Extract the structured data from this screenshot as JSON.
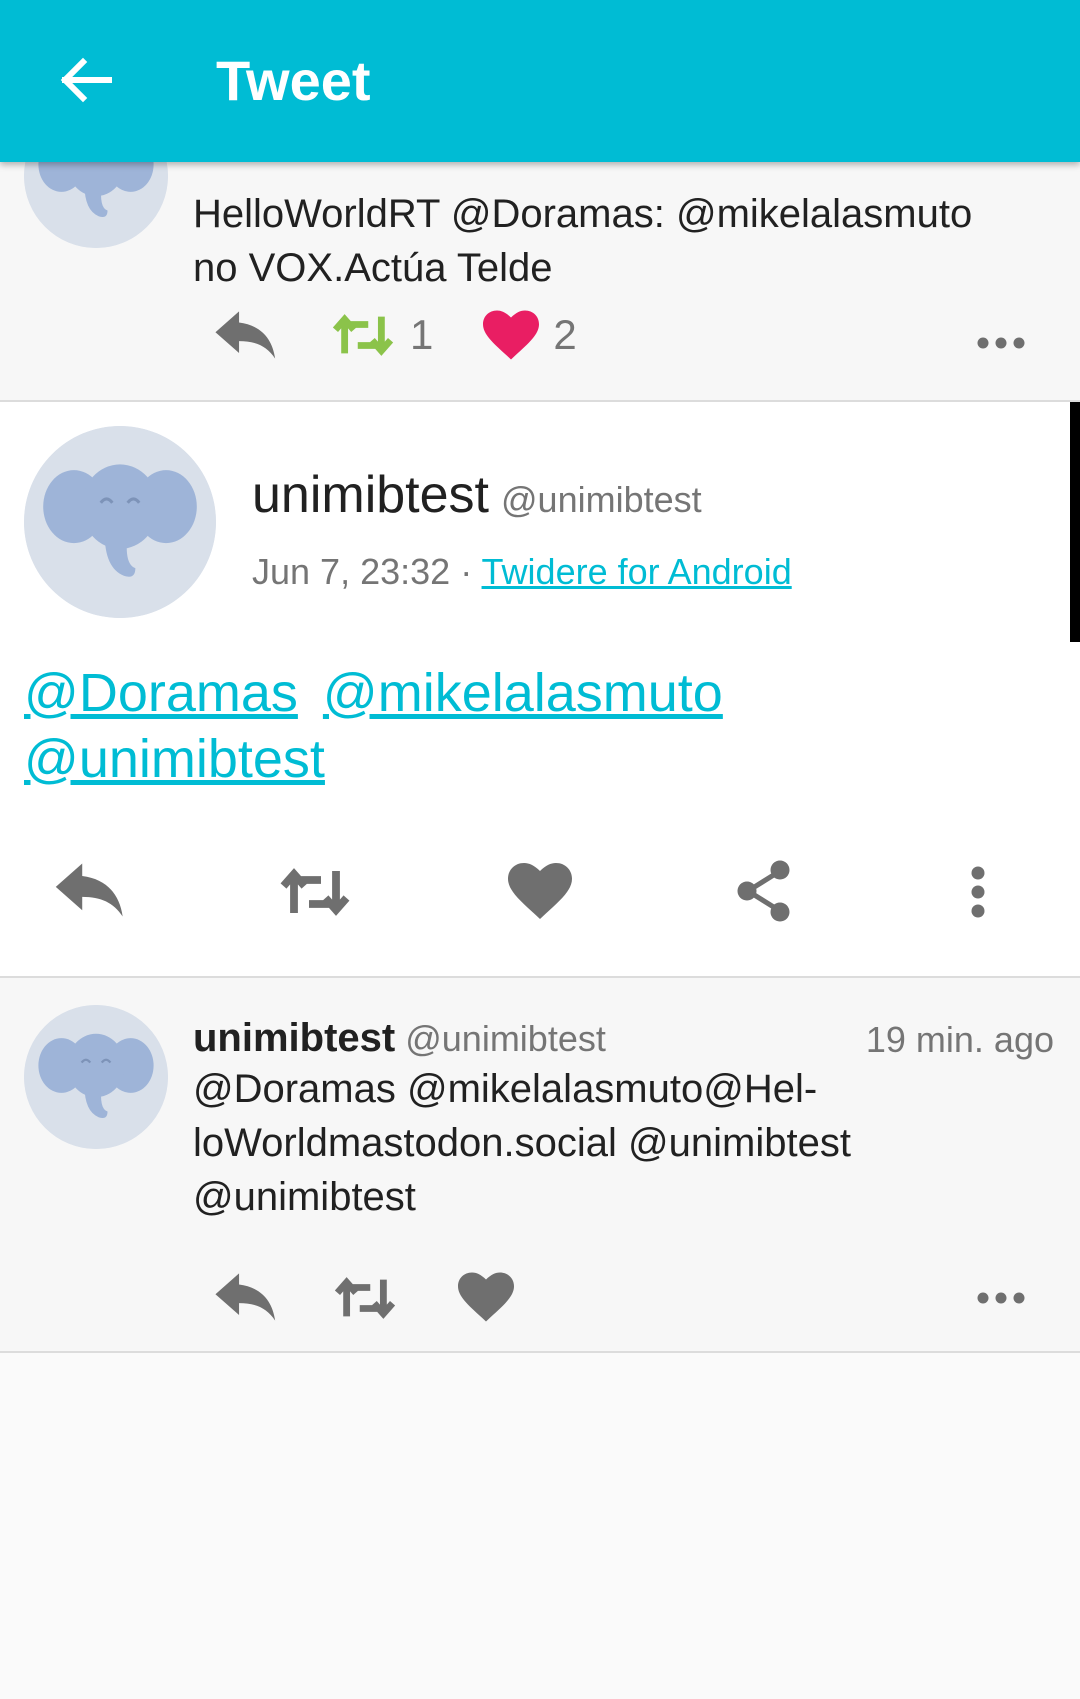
{
  "appbar": {
    "title": "Tweet",
    "background": "#00BCD4",
    "back_icon": "arrow-left-icon"
  },
  "parent_tweet": {
    "text_lines": [
      "HelloWorldRT @Doramas: @mikelalasmuto",
      "no VOX.Actúa Telde"
    ],
    "retweet_count": "1",
    "like_count": "2",
    "retweet_color": "#8BC34A",
    "like_color": "#E91E63"
  },
  "main_tweet": {
    "name": "unimibtest",
    "handle": "@unimibtest",
    "timestamp": "Jun 7, 23:32",
    "separator": "·",
    "source": "Twidere for Android",
    "mentions": [
      "@Doramas",
      "@mikelalasmuto",
      "@unimibtest"
    ],
    "actions": [
      "reply-icon",
      "retweet-icon",
      "heart-icon",
      "share-icon",
      "more-vert-icon"
    ]
  },
  "reply_tweet": {
    "name": "unimibtest",
    "handle": "@unimibtest",
    "time": "19 min. ago",
    "text_lines": [
      "@Doramas @mikelalasmuto@Hel-",
      "loWorldmastodon.social @unimibtest",
      "@unimibtest"
    ]
  },
  "colors": {
    "link": "#00BCD4",
    "secondary_text": "#757575",
    "icon": "#6f6f6f"
  }
}
